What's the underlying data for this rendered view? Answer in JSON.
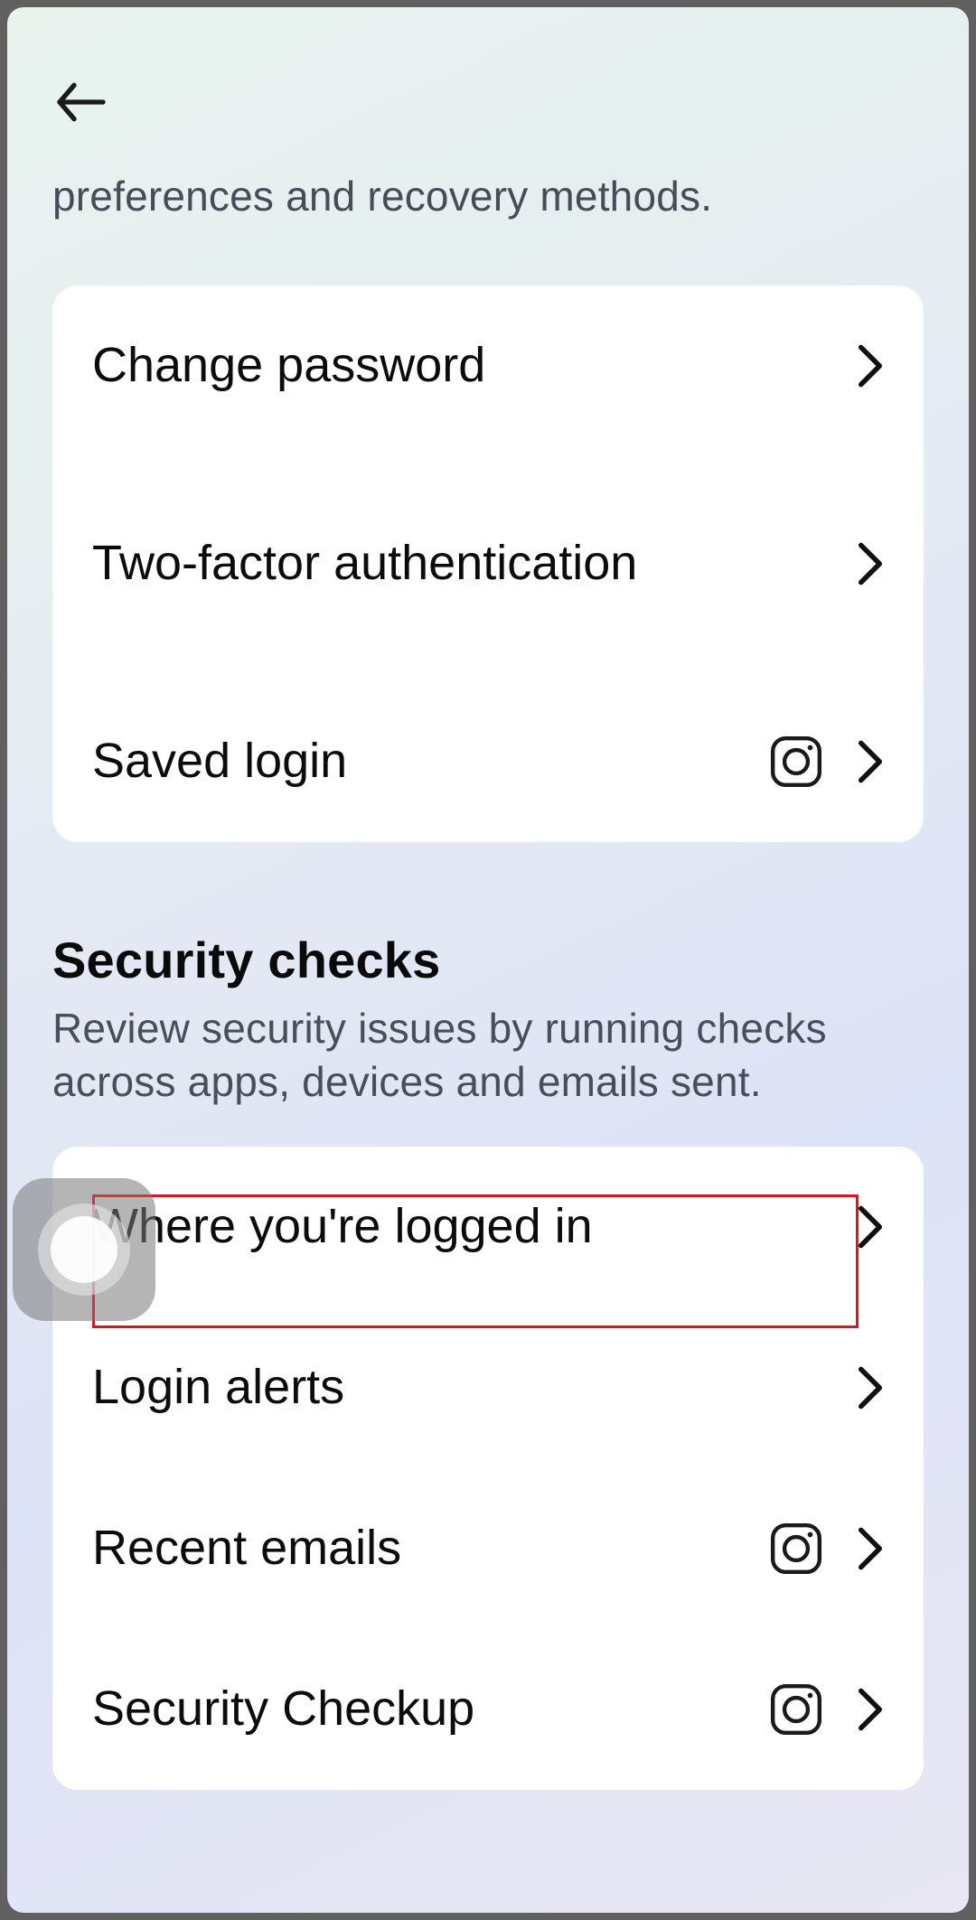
{
  "header": {
    "subtext": "preferences and recovery methods."
  },
  "loginCard": {
    "items": [
      {
        "label": "Change password",
        "icon": null
      },
      {
        "label": "Two-factor authentication",
        "icon": null
      },
      {
        "label": "Saved login",
        "icon": "instagram"
      }
    ]
  },
  "securitySection": {
    "title": "Security checks",
    "description": "Review security issues by running checks across apps, devices and emails sent."
  },
  "securityCard": {
    "items": [
      {
        "label": "Where you're logged in",
        "icon": null,
        "highlighted": true
      },
      {
        "label": "Login alerts",
        "icon": null
      },
      {
        "label": "Recent emails",
        "icon": "instagram"
      },
      {
        "label": "Security Checkup",
        "icon": "instagram"
      }
    ]
  }
}
